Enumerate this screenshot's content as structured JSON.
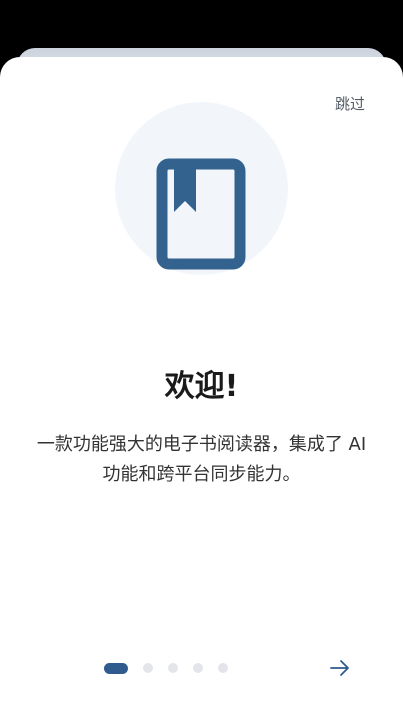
{
  "onboarding": {
    "skip_label": "跳过",
    "title": "欢迎!",
    "description": "一款功能强大的电子书阅读器，集成了 AI 功能和跨平台同步能力。",
    "current_page": 1,
    "total_pages": 5,
    "icons": {
      "hero": "bookmarked-book-icon",
      "next": "arrow-right-icon"
    },
    "colors": {
      "accent": "#2f5b8e",
      "hero_circle": "#f2f6fb",
      "dot_inactive": "#e3e5ea"
    }
  }
}
